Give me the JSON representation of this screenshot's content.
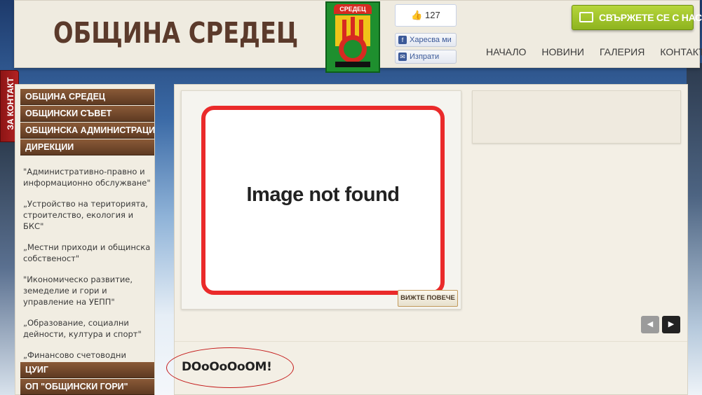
{
  "header": {
    "site_title": "ОБЩИНА СРЕДЕЦ",
    "crest_label": "СРЕДЕЦ",
    "like_count": "127",
    "like_button": "Харесва ми",
    "send_button": "Изпрати",
    "contact_button": "СВЪРЖЕТЕ СЕ С НАС",
    "nav": [
      "НАЧАЛО",
      "НОВИНИ",
      "ГАЛЕРИЯ",
      "КОНТАКТИ"
    ]
  },
  "side_tab": "ЗА КОНТАКТ",
  "sidebar": {
    "buttons_top": [
      "ОБЩИНА СРЕДЕЦ",
      "ОБЩИНСКИ СЪВЕТ",
      "ОБЩИНСКА АДМИНИСТРАЦИЯ",
      "ДИРЕКЦИИ"
    ],
    "directorates": [
      "\"Административно-правно и информационно обслужване\"",
      "„Устройство на територията, строителство, екология и БКС\"",
      "„Местни приходи и общинска собственост\"",
      "\"Икономическо развитие, земеделие и гори и управление на УЕПП\"",
      "„Образование, социални дейности, култура и спорт\"",
      "„Финансово счетоводни дейности и човешки ресурси\""
    ],
    "buttons_bottom": [
      "ЦУИГ",
      "ОП \"ОБЩИНСКИ ГОРИ\""
    ]
  },
  "slider": {
    "image_alt": "Image not found",
    "more_button": "ВИЖТЕ ПОВЕЧЕ"
  },
  "bottom_text": "DOoOoOoOM!",
  "colors": {
    "brown_button": "#6f4529",
    "contact_green": "#9dc22a",
    "side_tab_red": "#a01c1c"
  }
}
